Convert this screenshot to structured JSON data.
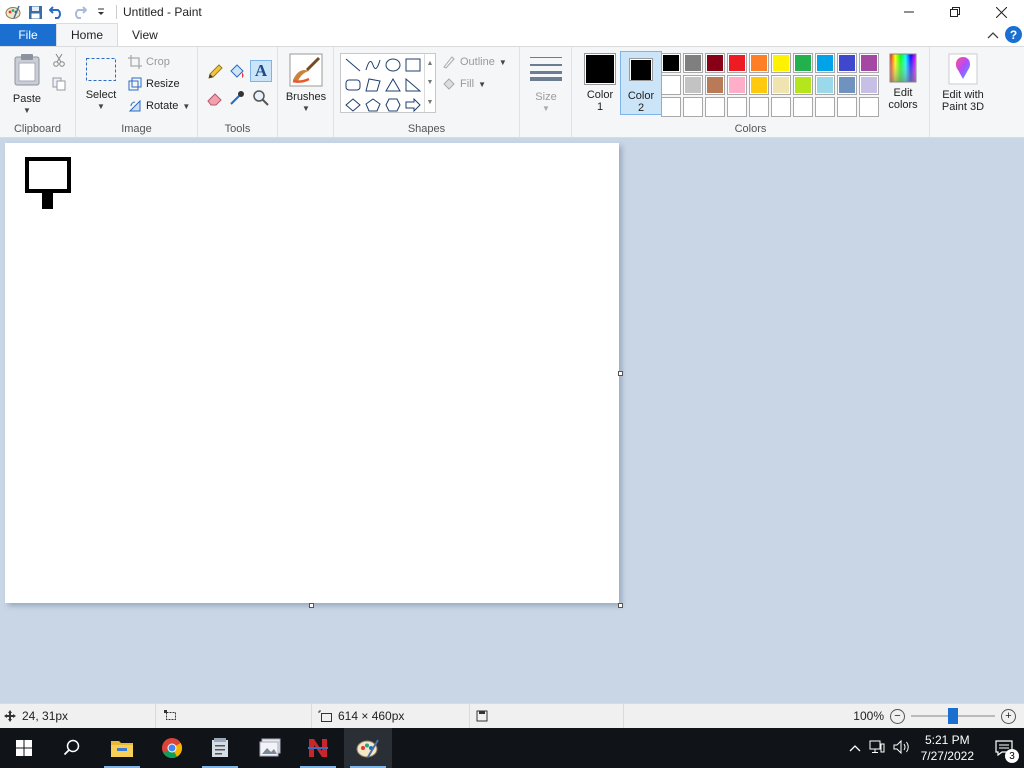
{
  "window": {
    "title": "Untitled - Paint"
  },
  "tabs": {
    "file": "File",
    "home": "Home",
    "view": "View"
  },
  "ribbon": {
    "clipboard": {
      "label": "Clipboard",
      "paste": "Paste"
    },
    "image": {
      "label": "Image",
      "select": "Select",
      "crop": "Crop",
      "resize": "Resize",
      "rotate": "Rotate"
    },
    "tools": {
      "label": "Tools"
    },
    "brushes": {
      "label": "Brushes"
    },
    "shapes": {
      "label": "Shapes",
      "outline": "Outline",
      "fill": "Fill"
    },
    "size": {
      "label": "Size"
    },
    "colors": {
      "label": "Colors",
      "color1_line1": "Color",
      "color1_line2": "1",
      "color2_line1": "Color",
      "color2_line2": "2",
      "color1_value": "#000000",
      "color2_value": "#000000",
      "edit_colors_line1": "Edit",
      "edit_colors_line2": "colors",
      "paint3d_line1": "Edit with",
      "paint3d_line2": "Paint 3D",
      "palette": [
        "#000000",
        "#7f7f7f",
        "#880015",
        "#ed1c24",
        "#ff7f27",
        "#fff200",
        "#22b14c",
        "#00a2e8",
        "#3f48cc",
        "#a349a4",
        "#ffffff",
        "#c3c3c3",
        "#b97a57",
        "#ffaec9",
        "#ffc90e",
        "#efe4b0",
        "#b5e61d",
        "#99d9ea",
        "#7092be",
        "#c8bfe7",
        "",
        "",
        "",
        "",
        "",
        "",
        "",
        "",
        "",
        ""
      ]
    }
  },
  "status": {
    "cursor_pos": "24, 31px",
    "image_size": "614 × 460px",
    "zoom": "100%",
    "zoom_fraction": 0.5
  },
  "taskbar": {
    "time": "5:21 PM",
    "date": "7/27/2022",
    "notifications": "3"
  }
}
